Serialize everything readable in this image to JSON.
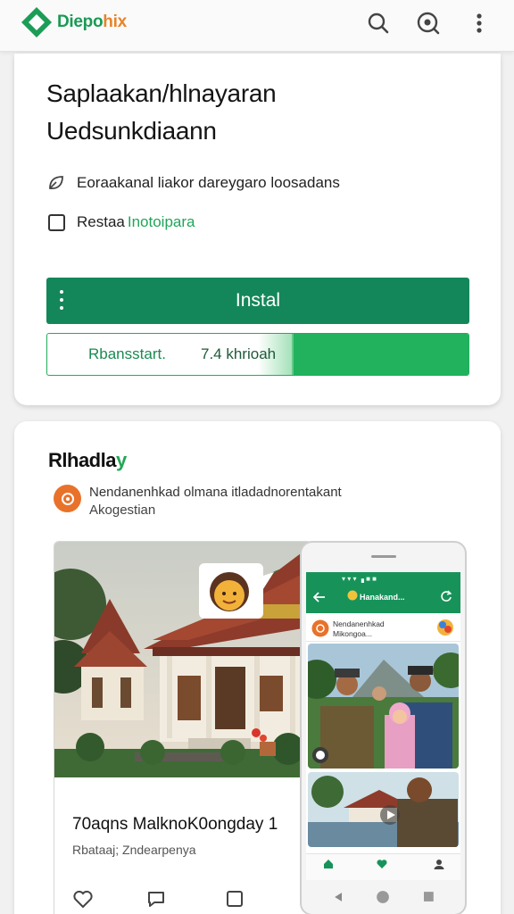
{
  "header": {
    "brand_prefix": "Diepo",
    "brand_suffix": "hix",
    "icons": [
      "search-icon",
      "lens-icon",
      "more-vert-icon"
    ],
    "accent": "#1a9a55"
  },
  "install_card": {
    "headline_line1": "Saplaakan/hlnayaran",
    "headline_line2": "Uedsunkdiaann",
    "option1": "Eoraakanal liakor dareygaro loosadans",
    "option2_prefix": "Restaa",
    "option2_highlight": "Inotoipara",
    "install_label": "Instal",
    "progress_label": "Rbansstart.",
    "progress_size": "7.4 khrioah",
    "progress_fraction": 0.42,
    "button_color": "#14875a"
  },
  "feature_card": {
    "title_prefix": "Rlhadla",
    "title_highlight": "y",
    "publisher_line1": "Nendanenhkad olmana itladadnorentakant",
    "publisher_line2": "Akogestian",
    "media_title": "70aqns MalknoK0ongday 1",
    "media_subtitle": "Rbataaj; Zndearpenya",
    "phone": {
      "status": "▾ ▾ ▾  ▗ ■ ■",
      "title": "Hanakand...",
      "row_line1": "Nendanenhkad",
      "row_line2": "Mikongoa..."
    }
  }
}
